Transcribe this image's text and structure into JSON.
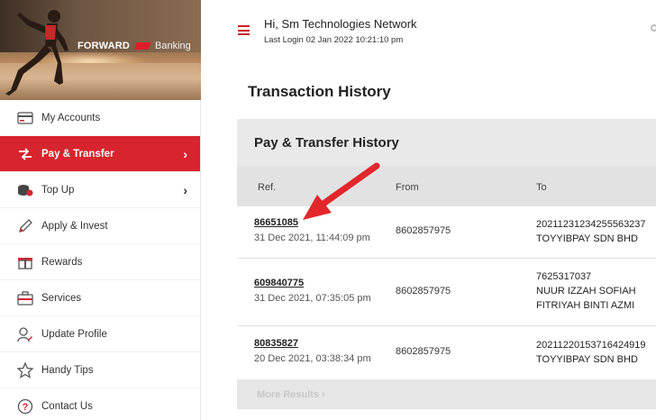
{
  "brand": {
    "forward": "FORWARD",
    "banking": "Banking"
  },
  "sidebar": {
    "items": [
      {
        "label": "My Accounts",
        "icon": "card-icon",
        "active": false,
        "chevron": ""
      },
      {
        "label": "Pay & Transfer",
        "icon": "transfer-icon",
        "active": true,
        "chevron": "›"
      },
      {
        "label": "Top Up",
        "icon": "coins-icon",
        "active": false,
        "chevron": "›"
      },
      {
        "label": "Apply & Invest",
        "icon": "pen-icon",
        "active": false,
        "chevron": ""
      },
      {
        "label": "Rewards",
        "icon": "gift-icon",
        "active": false,
        "chevron": ""
      },
      {
        "label": "Services",
        "icon": "briefcase-icon",
        "active": false,
        "chevron": ""
      },
      {
        "label": "Update Profile",
        "icon": "user-edit-icon",
        "active": false,
        "chevron": ""
      },
      {
        "label": "Handy Tips",
        "icon": "star-icon",
        "active": false,
        "chevron": ""
      },
      {
        "label": "Contact Us",
        "icon": "question-icon",
        "active": false,
        "chevron": ""
      }
    ]
  },
  "header": {
    "greeting": "Hi, Sm Technologies Network",
    "last_login": "Last Login 02 Jan 2022 10:21:10 pm"
  },
  "page_title": "Transaction History",
  "card": {
    "title": "Pay & Transfer History",
    "columns": {
      "ref": "Ref.",
      "from": "From",
      "to": "To"
    },
    "rows": [
      {
        "ref": "86651085",
        "date": "31 Dec 2021, 11:44:09 pm",
        "from": "8602857975",
        "to_line1": "20211231234255563237",
        "to_line2": "TOYYIBPAY SDN BHD",
        "to_line3": ""
      },
      {
        "ref": "609840775",
        "date": "31 Dec 2021, 07:35:05 pm",
        "from": "8602857975",
        "to_line1": "7625317037",
        "to_line2": "NUUR IZZAH SOFIAH",
        "to_line3": "FITRIYAH BINTI AZMI"
      },
      {
        "ref": "80835827",
        "date": "20 Dec 2021, 03:38:34 pm",
        "from": "8602857975",
        "to_line1": "20211220153716424919",
        "to_line2": "TOYYIBPAY SDN BHD",
        "to_line3": ""
      }
    ],
    "more_results": "More Results ›"
  },
  "colors": {
    "accent": "#d8242e",
    "arrow": "#e3262c"
  }
}
